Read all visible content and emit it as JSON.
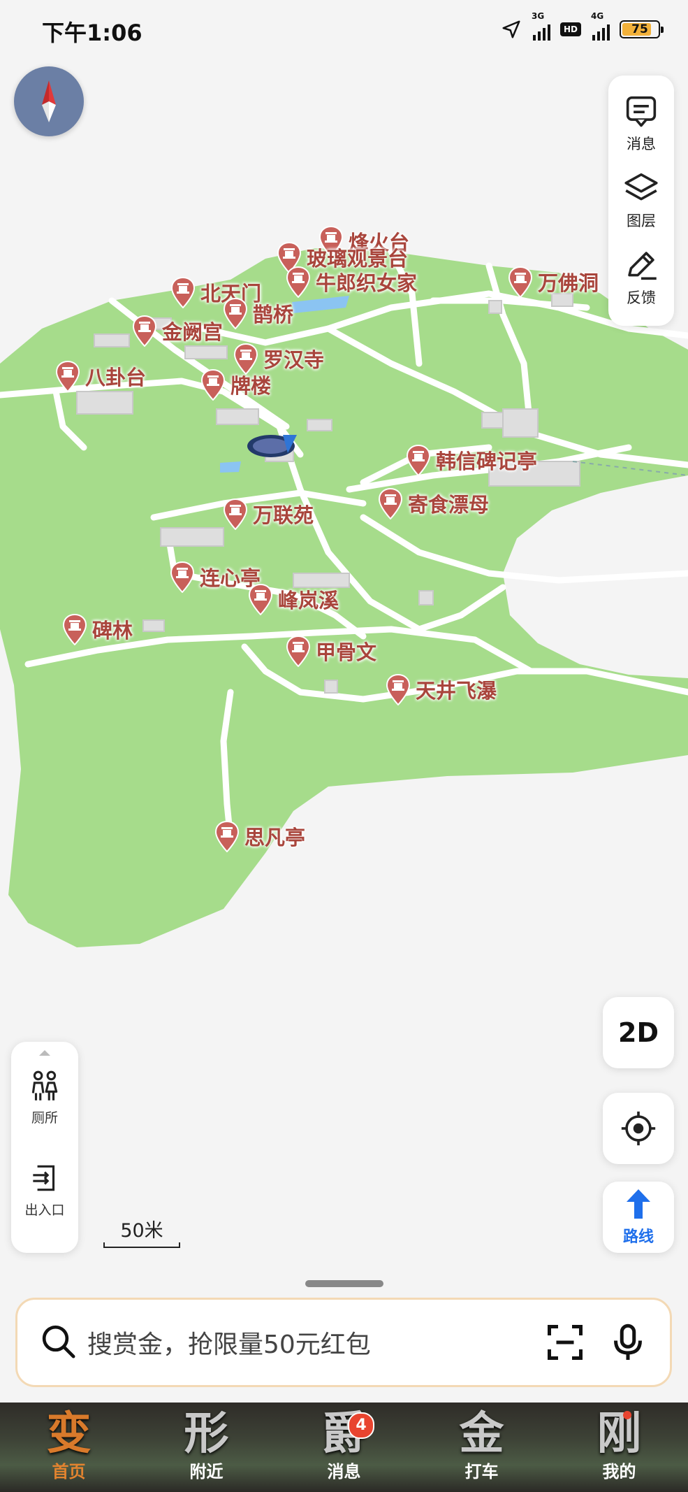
{
  "status_bar": {
    "time": "下午1:06",
    "network_1": "3G",
    "hd": "HD",
    "network_2": "4G",
    "battery": "75",
    "battery_level": 0.75
  },
  "map": {
    "colors": {
      "park": "#a6dc8b",
      "path": "#ffffff",
      "water": "#8bc4f2",
      "building": "#dedede",
      "poi": "#c8605a"
    },
    "pois": [
      {
        "name": "烽火台"
      },
      {
        "name": "玻璃观景台"
      },
      {
        "name": "牛郎织女家"
      },
      {
        "name": "万佛洞"
      },
      {
        "name": "北天门"
      },
      {
        "name": "鹊桥"
      },
      {
        "name": "金阙宫"
      },
      {
        "name": "罗汉寺"
      },
      {
        "name": "八卦台"
      },
      {
        "name": "牌楼"
      },
      {
        "name": "韩信碑记亭"
      },
      {
        "name": "寄食漂母"
      },
      {
        "name": "万联苑"
      },
      {
        "name": "连心亭"
      },
      {
        "name": "峰岚溪"
      },
      {
        "name": "碑林"
      },
      {
        "name": "甲骨文"
      },
      {
        "name": "天井飞瀑"
      },
      {
        "name": "思凡亭"
      }
    ]
  },
  "right_tools": [
    {
      "label": "消息",
      "icon": "message-icon"
    },
    {
      "label": "图层",
      "icon": "layers-icon"
    },
    {
      "label": "反馈",
      "icon": "feedback-icon"
    }
  ],
  "buttons": {
    "mode_2d": "2D",
    "route": "路线"
  },
  "left_tools": [
    {
      "label": "厕所",
      "icon": "restroom-icon"
    },
    {
      "label": "出入口",
      "icon": "entrance-icon"
    }
  ],
  "scale": "50米",
  "search": {
    "placeholder": "搜赏金，抢限量50元红包"
  },
  "tabs": [
    {
      "glyph": "变",
      "label": "首页",
      "active": true
    },
    {
      "glyph": "形",
      "label": "附近"
    },
    {
      "glyph": "爵",
      "label": "消息",
      "badge": "4"
    },
    {
      "glyph": "金",
      "label": "打车"
    },
    {
      "glyph": "刚",
      "label": "我的",
      "dot": true
    }
  ]
}
